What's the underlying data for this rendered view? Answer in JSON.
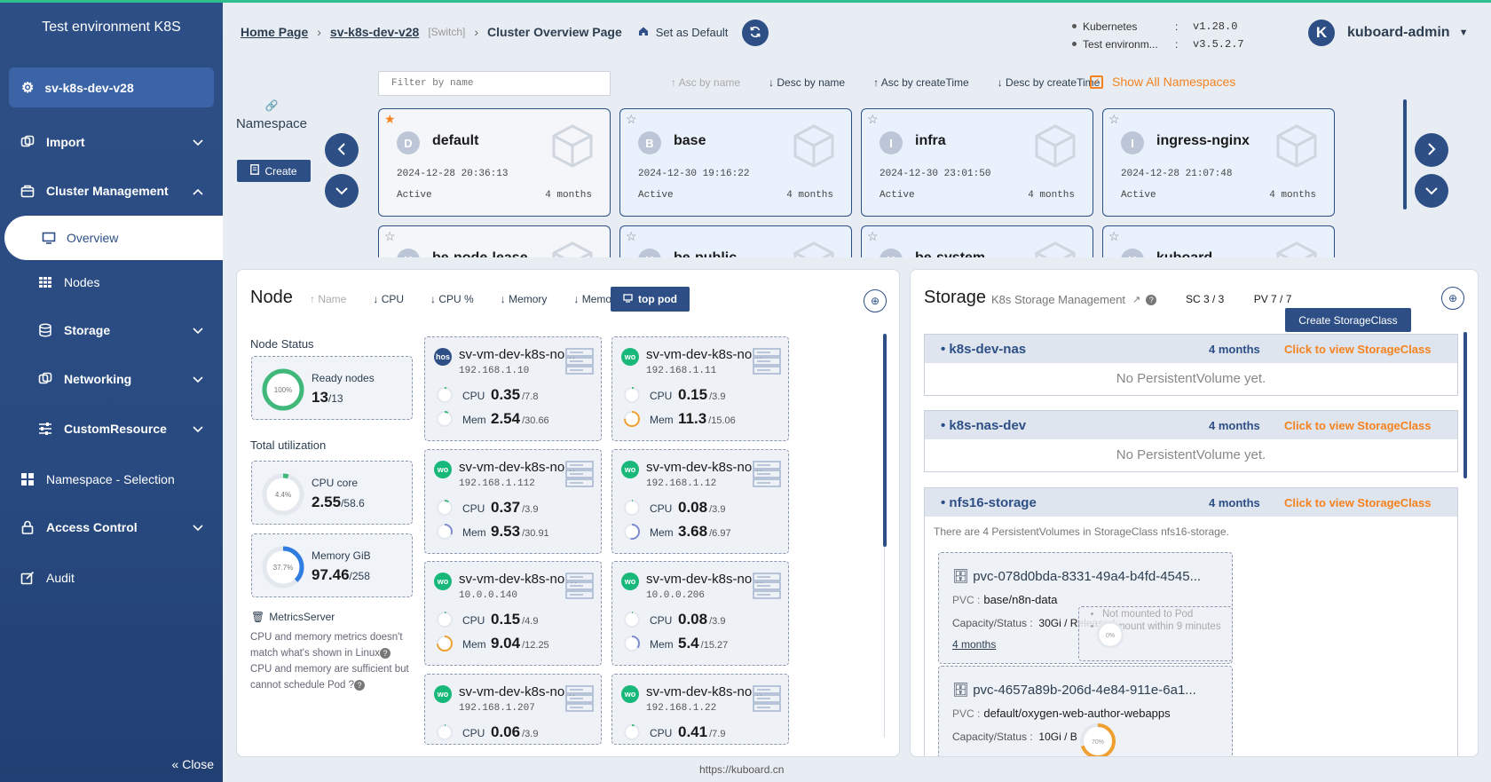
{
  "sidebar": {
    "title": "Test environment K8S",
    "cluster": "sv-k8s-dev-v28",
    "items": {
      "import": "Import",
      "cluster_management": "Cluster Management",
      "overview": "Overview",
      "nodes": "Nodes",
      "storage": "Storage",
      "networking": "Networking",
      "custom_resource": "CustomResource",
      "namespace_selection": "Namespace - Selection",
      "access_control": "Access Control",
      "audit": "Audit"
    },
    "close": "Close"
  },
  "header": {
    "home": "Home Page",
    "cluster": "sv-k8s-dev-v28",
    "switch": "[Switch]",
    "current": "Cluster Overview Page",
    "set_default": "Set as Default",
    "info": [
      {
        "key": "Kubernetes",
        "value": "v1.28.0"
      },
      {
        "key": "Test environm...",
        "value": "v3.5.2.7"
      }
    ],
    "avatar_letter": "K",
    "user": "kuboard-admin"
  },
  "namespaces": {
    "label": "Namespace",
    "create": "Create",
    "filter_placeholder": "Filter by name",
    "sort": [
      "Asc by name",
      "Desc by name",
      "Asc by createTime",
      "Desc by createTime"
    ],
    "show_all": "Show All Namespaces",
    "cards": [
      {
        "letter": "D",
        "name": "default",
        "date": "2024-12-28 20:36:13",
        "status": "Active",
        "age": "4 months"
      },
      {
        "letter": "B",
        "name": "base",
        "date": "2024-12-30 19:16:22",
        "status": "Active",
        "age": "4 months"
      },
      {
        "letter": "I",
        "name": "infra",
        "date": "2024-12-30 23:01:50",
        "status": "Active",
        "age": "4 months"
      },
      {
        "letter": "I",
        "name": "ingress-nginx",
        "date": "2024-12-28 21:07:48",
        "status": "Active",
        "age": "4 months"
      }
    ],
    "partial_cards": [
      {
        "letter": "K",
        "name": "be-node-lease"
      },
      {
        "letter": "K",
        "name": "be-public"
      },
      {
        "letter": "K",
        "name": "be-system"
      },
      {
        "letter": "K",
        "name": "kuboard"
      }
    ]
  },
  "node_panel": {
    "title": "Node",
    "sort": [
      "Name",
      "CPU",
      "CPU %",
      "Memory",
      "Memory %"
    ],
    "top_pod": "top pod",
    "node_status_label": "Node Status",
    "ready_label": "Ready nodes",
    "ready_value": "13",
    "ready_total": "/13",
    "ready_pct": "100%",
    "ready_ratio": 1.0,
    "total_label": "Total utilization",
    "cpu_label": "CPU core",
    "cpu_value": "2.55",
    "cpu_total": "/58.6",
    "cpu_pct": "4.4%",
    "cpu_ratio": 0.044,
    "mem_label": "Memory GiB",
    "mem_value": "97.46",
    "mem_total": "/258",
    "mem_pct": "37.7%",
    "mem_ratio": 0.377,
    "metrics_server": "MetricsServer",
    "help1": "CPU and memory metrics doesn't match what's shown in Linux",
    "help2": "CPU and memory are sufficient but cannot schedule Pod ?",
    "nodes": [
      {
        "role": "host",
        "name": "sv-vm-dev-k8s-no...",
        "ip": "192.168.1.10",
        "cpu": "0.35",
        "cpu_total": "/7.8",
        "cpu_pct": "4%",
        "mem": "2.54",
        "mem_total": "/30.66",
        "mem_pct": "8%"
      },
      {
        "role": "worker",
        "name": "sv-vm-dev-k8s-no...",
        "ip": "192.168.1.11",
        "cpu": "0.15",
        "cpu_total": "/3.9",
        "cpu_pct": "4%",
        "mem": "11.3",
        "mem_total": "/15.06",
        "mem_pct": "75%"
      },
      {
        "role": "worker",
        "name": "sv-vm-dev-k8s-no...",
        "ip": "192.168.1.112",
        "cpu": "0.37",
        "cpu_total": "/3.9",
        "cpu_pct": "9%",
        "mem": "9.53",
        "mem_total": "/30.91",
        "mem_pct": "31%"
      },
      {
        "role": "worker",
        "name": "sv-vm-dev-k8s-no...",
        "ip": "192.168.1.12",
        "cpu": "0.08",
        "cpu_total": "/3.9",
        "cpu_pct": "2%",
        "mem": "3.68",
        "mem_total": "/6.97",
        "mem_pct": "53%"
      },
      {
        "role": "worker",
        "name": "sv-vm-dev-k8s-nod...",
        "ip": "10.0.0.140",
        "cpu": "0.15",
        "cpu_total": "/4.9",
        "cpu_pct": "3%",
        "mem": "9.04",
        "mem_total": "/12.25",
        "mem_pct": "74%"
      },
      {
        "role": "worker",
        "name": "sv-vm-dev-k8s-no...",
        "ip": "10.0.0.206",
        "cpu": "0.08",
        "cpu_total": "/3.9",
        "cpu_pct": "2%",
        "mem": "5.4",
        "mem_total": "/15.27",
        "mem_pct": "35%"
      },
      {
        "role": "worker",
        "name": "sv-vm-dev-k8s-no...",
        "ip": "192.168.1.207",
        "cpu": "0.06",
        "cpu_total": "/3.9",
        "cpu_pct": "2%"
      },
      {
        "role": "worker",
        "name": "sv-vm-dev-k8s-no...",
        "ip": "192.168.1.22",
        "cpu": "0.41",
        "cpu_total": "/7.9",
        "cpu_pct": "5%"
      }
    ],
    "cpu_label_short": "CPU",
    "mem_label_short": "Mem",
    "role_text": {
      "host": "hos",
      "worker": "wo"
    }
  },
  "storage_panel": {
    "title": "Storage",
    "subtitle": "K8s Storage Management",
    "sc_count": "SC 3 / 3",
    "pv_count": "PV 7 / 7",
    "create_sc": "Create StorageClass",
    "classes": [
      {
        "name": "k8s-dev-nas",
        "age": "4 months",
        "link": "Click to view StorageClass",
        "empty": "No PersistentVolume yet."
      },
      {
        "name": "k8s-nas-dev",
        "age": "4 months",
        "link": "Click to view StorageClass",
        "empty": "No PersistentVolume yet."
      },
      {
        "name": "nfs16-storage",
        "age": "4 months",
        "link": "Click to view StorageClass",
        "info": "There are 4 PersistentVolumes in StorageClass nfs16-storage."
      }
    ],
    "pvs": [
      {
        "name": "pvc-078d0bda-8331-49a4-b4fd-4545...",
        "pvc": "base/n8n-data",
        "capacity": "30Gi / Released",
        "age": "4 months",
        "mount1": "Not mounted to Pod",
        "mount2": "Or mount within 9 minutes",
        "usage": "0%"
      },
      {
        "name": "pvc-4657a89b-206d-4e84-911e-6a1...",
        "pvc": "default/oxygen-web-author-webapps",
        "capacity": "10Gi / B",
        "usage": "70%"
      }
    ],
    "pvc_label": "PVC :",
    "cap_label": "Capacity/Status :"
  },
  "footer": "https://kuboard.cn",
  "colors": {
    "brand": "#2d4f86",
    "accent": "#f5821f",
    "worker": "#18b87a",
    "ring_ok": "#3fb87a",
    "ring_blue": "#2f7de1",
    "ring_orange": "#f0a030"
  }
}
